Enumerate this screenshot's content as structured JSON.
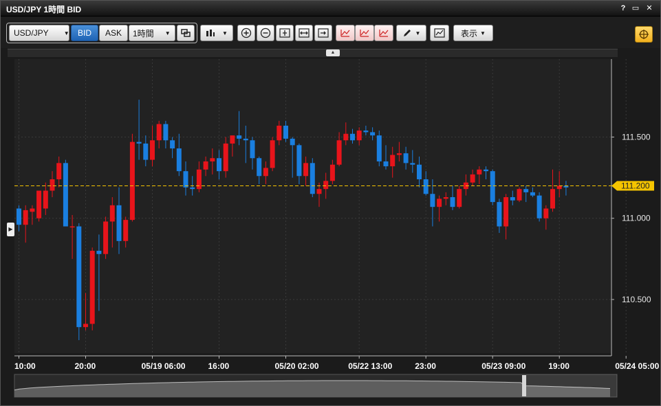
{
  "window": {
    "title": "USD/JPY 1時間 BID",
    "help_label": "?",
    "maximize_label": "▭",
    "close_label": "✕"
  },
  "toolbar": {
    "symbol": "USD/JPY",
    "bid_label": "BID",
    "ask_label": "ASK",
    "timeframe": "1時間",
    "display_label": "表示",
    "selected_price_side": "BID"
  },
  "colors": {
    "up": "#e8141b",
    "down": "#1a7fe0",
    "price_line": "#f5c400",
    "grid": "#3a3a3a",
    "background": "#222222"
  },
  "current_price": {
    "label": "111.200",
    "value": 111.2
  },
  "chart_data": {
    "type": "candlestick",
    "title": "USD/JPY 1時間 BID",
    "ylim": [
      110.17,
      111.98
    ],
    "y_ticks": [
      "111.500",
      "111.000",
      "110.500"
    ],
    "y_tick_values": [
      111.5,
      111.0,
      110.5
    ],
    "x_ticks": [
      "10:00",
      "20:00",
      "05/19 06:00",
      "16:00",
      "05/20 02:00",
      "05/22 13:00",
      "23:00",
      "05/23 09:00",
      "19:00",
      "05/24 05:00"
    ],
    "x_tick_index": [
      0,
      10,
      20,
      30,
      40,
      51,
      61,
      71,
      81,
      91
    ],
    "ohlc": [
      [
        111.06,
        111.08,
        110.92,
        110.96
      ],
      [
        110.96,
        111.08,
        110.85,
        111.05
      ],
      [
        111.04,
        111.08,
        110.96,
        111.06
      ],
      [
        111.0,
        111.16,
        110.98,
        111.17
      ],
      [
        111.06,
        111.22,
        111.02,
        111.17
      ],
      [
        111.17,
        111.29,
        111.13,
        111.24
      ],
      [
        111.24,
        111.38,
        111.19,
        111.34
      ],
      [
        111.34,
        111.36,
        110.98,
        110.95
      ],
      [
        110.95,
        111.02,
        110.75,
        110.95
      ],
      [
        110.95,
        110.97,
        110.25,
        110.33
      ],
      [
        110.33,
        110.54,
        110.31,
        110.35
      ],
      [
        110.35,
        110.82,
        110.31,
        110.8
      ],
      [
        110.8,
        110.9,
        110.43,
        110.78
      ],
      [
        110.78,
        111.01,
        110.75,
        110.98
      ],
      [
        110.98,
        111.13,
        110.82,
        111.08
      ],
      [
        111.08,
        111.19,
        110.78,
        110.86
      ],
      [
        110.86,
        111.01,
        110.82,
        110.99
      ],
      [
        110.99,
        111.52,
        110.98,
        111.47
      ],
      [
        111.47,
        111.73,
        111.36,
        111.46
      ],
      [
        111.46,
        111.51,
        111.32,
        111.36
      ],
      [
        111.36,
        111.57,
        111.32,
        111.48
      ],
      [
        111.48,
        111.6,
        111.43,
        111.58
      ],
      [
        111.58,
        111.6,
        111.43,
        111.48
      ],
      [
        111.48,
        111.5,
        111.37,
        111.43
      ],
      [
        111.43,
        111.52,
        111.26,
        111.29
      ],
      [
        111.29,
        111.35,
        111.14,
        111.19
      ],
      [
        111.19,
        111.26,
        111.14,
        111.18
      ],
      [
        111.18,
        111.35,
        111.16,
        111.3
      ],
      [
        111.3,
        111.38,
        111.26,
        111.35
      ],
      [
        111.35,
        111.43,
        111.27,
        111.37
      ],
      [
        111.37,
        111.42,
        111.24,
        111.29
      ],
      [
        111.29,
        111.5,
        111.25,
        111.46
      ],
      [
        111.46,
        111.51,
        111.38,
        111.51
      ],
      [
        111.51,
        111.66,
        111.45,
        111.49
      ],
      [
        111.49,
        111.57,
        111.34,
        111.48
      ],
      [
        111.48,
        111.5,
        111.3,
        111.37
      ],
      [
        111.37,
        111.38,
        111.21,
        111.26
      ],
      [
        111.26,
        111.35,
        111.21,
        111.31
      ],
      [
        111.31,
        111.5,
        111.29,
        111.48
      ],
      [
        111.48,
        111.6,
        111.45,
        111.57
      ],
      [
        111.57,
        111.6,
        111.47,
        111.49
      ],
      [
        111.49,
        111.5,
        111.25,
        111.45
      ],
      [
        111.45,
        111.46,
        111.21,
        111.26
      ],
      [
        111.26,
        111.38,
        111.2,
        111.34
      ],
      [
        111.34,
        111.37,
        111.13,
        111.15
      ],
      [
        111.15,
        111.22,
        111.07,
        111.18
      ],
      [
        111.18,
        111.28,
        111.12,
        111.23
      ],
      [
        111.23,
        111.36,
        111.21,
        111.33
      ],
      [
        111.33,
        111.53,
        111.32,
        111.48
      ],
      [
        111.48,
        111.59,
        111.45,
        111.52
      ],
      [
        111.52,
        111.55,
        111.46,
        111.48
      ],
      [
        111.48,
        111.56,
        111.45,
        111.54
      ],
      [
        111.54,
        111.57,
        111.51,
        111.53
      ],
      [
        111.53,
        111.56,
        111.48,
        111.51
      ],
      [
        111.51,
        111.54,
        111.32,
        111.35
      ],
      [
        111.35,
        111.45,
        111.3,
        111.32
      ],
      [
        111.32,
        111.44,
        111.25,
        111.39
      ],
      [
        111.39,
        111.47,
        111.35,
        111.4
      ],
      [
        111.4,
        111.44,
        111.3,
        111.34
      ],
      [
        111.34,
        111.42,
        111.28,
        111.33
      ],
      [
        111.33,
        111.38,
        111.19,
        111.24
      ],
      [
        111.24,
        111.29,
        111.14,
        111.15
      ],
      [
        111.15,
        111.24,
        110.95,
        111.07
      ],
      [
        111.07,
        111.14,
        110.98,
        111.12
      ],
      [
        111.12,
        111.16,
        111.08,
        111.13
      ],
      [
        111.13,
        111.2,
        111.05,
        111.07
      ],
      [
        111.07,
        111.2,
        111.06,
        111.18
      ],
      [
        111.18,
        111.27,
        111.14,
        111.22
      ],
      [
        111.22,
        111.3,
        111.2,
        111.27
      ],
      [
        111.27,
        111.32,
        111.21,
        111.3
      ],
      [
        111.3,
        111.32,
        111.24,
        111.29
      ],
      [
        111.29,
        111.3,
        111.08,
        111.1
      ],
      [
        111.1,
        111.12,
        110.91,
        110.95
      ],
      [
        110.95,
        111.15,
        110.87,
        111.13
      ],
      [
        111.13,
        111.17,
        111.08,
        111.11
      ],
      [
        111.11,
        111.19,
        111.1,
        111.18
      ],
      [
        111.18,
        111.2,
        111.1,
        111.16
      ],
      [
        111.16,
        111.19,
        111.13,
        111.14
      ],
      [
        111.14,
        111.16,
        110.98,
        111.0
      ],
      [
        111.0,
        111.08,
        110.93,
        111.06
      ],
      [
        111.06,
        111.3,
        111.04,
        111.18
      ],
      [
        111.18,
        111.29,
        111.13,
        111.2
      ],
      [
        111.2,
        111.23,
        111.14,
        111.19
      ]
    ],
    "overview_label": "navigator"
  }
}
